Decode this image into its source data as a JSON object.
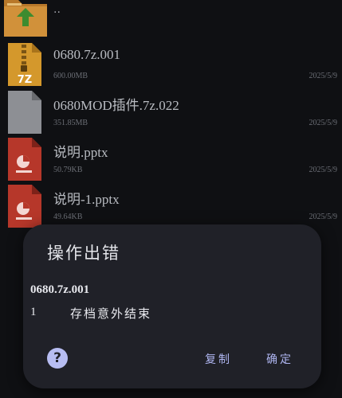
{
  "file_list": {
    "parent_label": "..",
    "files": [
      {
        "name": "0680.7z.001",
        "size": "600.00MB",
        "date": "2025/5/9",
        "icon": "7z-archive-icon",
        "icon_text": "7Z"
      },
      {
        "name": "0680MOD插件.7z.022",
        "size": "351.85MB",
        "date": "2025/5/9",
        "icon": "generic-file-icon"
      },
      {
        "name": "说明.pptx",
        "size": "50.79KB",
        "date": "2025/5/9",
        "icon": "pptx-file-icon"
      },
      {
        "name": "说明-1.pptx",
        "size": "49.64KB",
        "date": "2025/5/9",
        "icon": "pptx-file-icon"
      }
    ]
  },
  "dialog": {
    "title": "操作出错",
    "filename": "0680.7z.001",
    "error_code": "1",
    "error_message": "存档意外结束",
    "help_icon": "question-icon",
    "help_glyph": "?",
    "copy_label": "复制",
    "ok_label": "确定"
  },
  "colors": {
    "background": "#0f1013",
    "dialog_bg": "#202128",
    "accent": "#aeb5f0",
    "folder": "#c98a2e",
    "pptx_red": "#c0392b"
  }
}
